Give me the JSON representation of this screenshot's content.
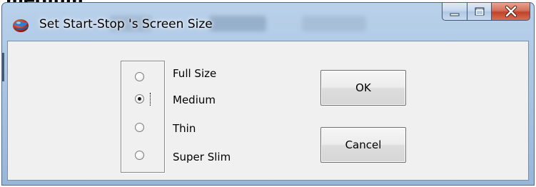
{
  "header_fragment": "medium",
  "window": {
    "title": "Set Start-Stop 's Screen Size",
    "minimize_icon": "minimize-icon",
    "maximize_icon": "maximize-icon",
    "close_icon": "close-icon",
    "app_icon": "globe-app-icon"
  },
  "screen_size": {
    "options": [
      {
        "label": "Full Size",
        "checked": false
      },
      {
        "label": "Medium",
        "checked": true
      },
      {
        "label": "Thin",
        "checked": false
      },
      {
        "label": "Super Slim",
        "checked": false
      }
    ],
    "selected": "Medium"
  },
  "buttons": {
    "ok_label": "OK",
    "cancel_label": "Cancel"
  },
  "colors": {
    "titlebar": "#b9d1ea",
    "client_bg": "#f0f0f0",
    "close_button": "#c0432a"
  }
}
